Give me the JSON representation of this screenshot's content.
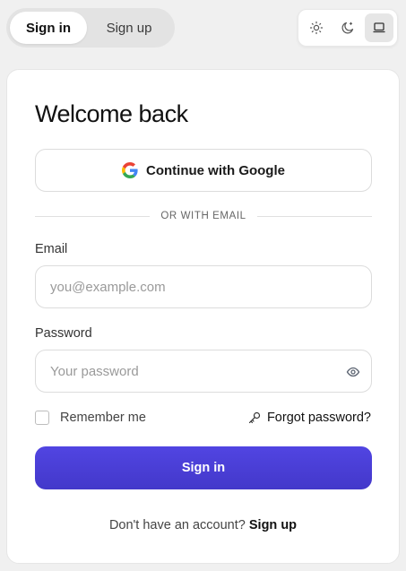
{
  "auth_tabs": {
    "sign_in": "Sign in",
    "sign_up": "Sign up"
  },
  "theme_switcher": {
    "options": [
      "sun-icon",
      "moon-icon",
      "laptop-icon"
    ],
    "selected": "laptop-icon"
  },
  "card": {
    "title": "Welcome back",
    "google_button": "Continue with Google",
    "divider_text": "OR WITH EMAIL",
    "email": {
      "label": "Email",
      "placeholder": "you@example.com",
      "value": ""
    },
    "password": {
      "label": "Password",
      "placeholder": "Your password",
      "value": ""
    },
    "remember_me": "Remember me",
    "forgot_password": "Forgot password?",
    "submit": "Sign in",
    "footer_text": "Don't have an account?",
    "footer_link": "Sign up"
  },
  "colors": {
    "primary": "#4a3fd8",
    "page_bg": "#f0f0f0"
  }
}
